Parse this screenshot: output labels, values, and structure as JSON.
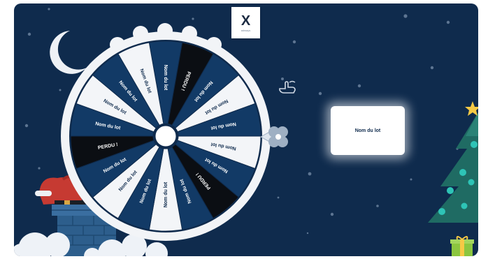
{
  "logo": {
    "mark": "X",
    "tagline": "adways"
  },
  "wheel": {
    "segments": [
      {
        "label": "Nom du lot",
        "theme": "navy"
      },
      {
        "label": "PERDU !",
        "theme": "black"
      },
      {
        "label": "Nom du lot",
        "theme": "navy"
      },
      {
        "label": "Nom du lot",
        "theme": "white"
      },
      {
        "label": "Nom du lot",
        "theme": "navy"
      },
      {
        "label": "Nom du lot",
        "theme": "white"
      },
      {
        "label": "Nom du lot",
        "theme": "navy"
      },
      {
        "label": "PERDU !",
        "theme": "black"
      },
      {
        "label": "Nom du lot",
        "theme": "navy"
      },
      {
        "label": "Nom du lot",
        "theme": "white"
      },
      {
        "label": "Nom du lot",
        "theme": "navy"
      },
      {
        "label": "Nom du lot",
        "theme": "white"
      },
      {
        "label": "Nom du lot",
        "theme": "navy"
      },
      {
        "label": "PERDU !",
        "theme": "black"
      },
      {
        "label": "Nom du lot",
        "theme": "navy"
      },
      {
        "label": "Nom du lot",
        "theme": "white"
      },
      {
        "label": "Nom du lot",
        "theme": "navy"
      },
      {
        "label": "Nom du lot",
        "theme": "white"
      }
    ]
  },
  "result": {
    "label": "Nom du lot"
  },
  "colors": {
    "background": "#0f2b4d",
    "navy": "#123a66",
    "black": "#0b0e13",
    "white": "#f3f5f8",
    "rim": "#f2f4f7",
    "tree": "#1f6b63",
    "ornament": "#2ec4b6",
    "star": "#f6c945",
    "santa_red": "#c63a32",
    "chimney": "#2d5e8c"
  },
  "icons": [
    "moon-icon",
    "hand-cursor-icon",
    "clover-pointer-icon",
    "christmas-tree-icon",
    "gift-icon",
    "santa-icon",
    "chimney-icon"
  ]
}
